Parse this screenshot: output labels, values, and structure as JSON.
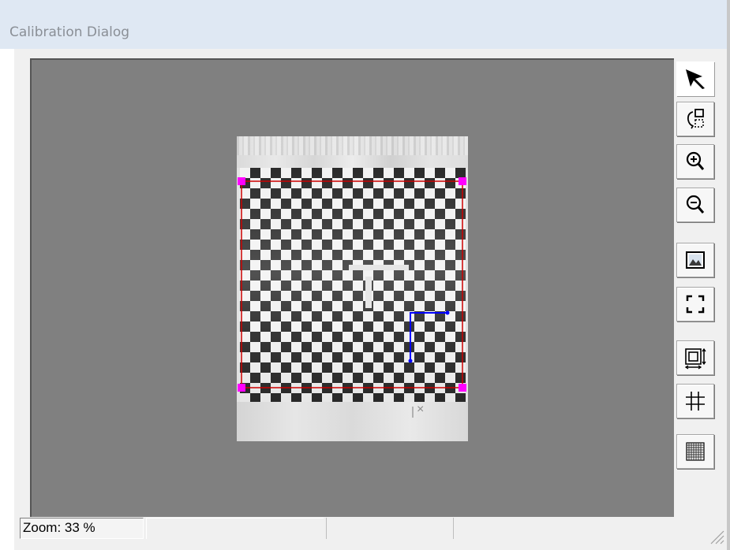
{
  "window": {
    "title": "Calibration Dialog"
  },
  "image_view": {
    "image_footer_mark": "×",
    "handle_color": "#ff00ff",
    "roi_color": "#cc0000",
    "axis_color": "#0000ff",
    "canvas_bg": "#808080"
  },
  "toolbar": {
    "buttons": [
      {
        "name": "select-tool-button",
        "icon": "arrow-cursor-icon",
        "active": true
      },
      {
        "name": "rotate-view-button",
        "icon": "rotate-frame-icon"
      },
      {
        "name": "zoom-in-button",
        "icon": "zoom-in-icon"
      },
      {
        "name": "zoom-out-button",
        "icon": "zoom-out-icon"
      },
      {
        "name": "show-image-button",
        "icon": "image-icon"
      },
      {
        "name": "fit-to-window-button",
        "icon": "fit-corners-icon"
      },
      {
        "name": "roi-size-button",
        "icon": "roi-resize-icon"
      },
      {
        "name": "grid-button",
        "icon": "grid-icon"
      },
      {
        "name": "dense-grid-button",
        "icon": "dense-grid-icon"
      }
    ]
  },
  "status": {
    "zoom_text": "Zoom: 33 %"
  }
}
